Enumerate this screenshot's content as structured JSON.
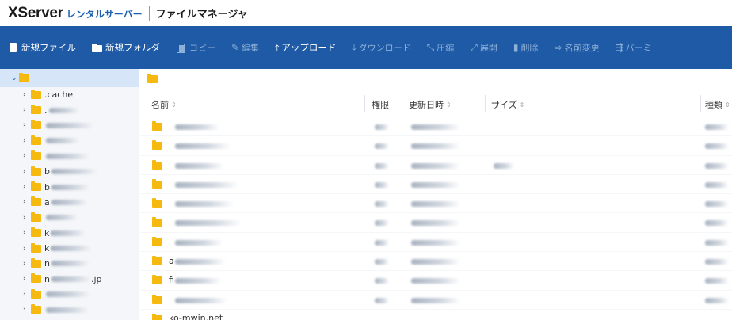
{
  "header": {
    "brand": "XServer",
    "brand_sub": "レンタルサーバー",
    "app_title": "ファイルマネージャ"
  },
  "toolbar": {
    "buttons": [
      {
        "label": "新規ファイル",
        "icon": "new-file-icon",
        "enabled": true
      },
      {
        "label": "新規フォルダ",
        "icon": "new-folder-icon",
        "enabled": true
      },
      {
        "label": "コピー",
        "icon": "copy-icon",
        "enabled": false
      },
      {
        "label": "編集",
        "icon": "pencil-icon",
        "enabled": false
      },
      {
        "label": "アップロード",
        "icon": "upload-icon",
        "enabled": true
      },
      {
        "label": "ダウンロード",
        "icon": "download-icon",
        "enabled": false
      },
      {
        "label": "圧縮",
        "icon": "compress-icon",
        "enabled": false
      },
      {
        "label": "展開",
        "icon": "expand-icon",
        "enabled": false
      },
      {
        "label": "削除",
        "icon": "trash-icon",
        "enabled": false
      },
      {
        "label": "名前変更",
        "icon": "rename-icon",
        "enabled": false
      },
      {
        "label": "パーミ",
        "icon": "permission-icon",
        "enabled": false
      }
    ]
  },
  "sidebar": {
    "items": [
      {
        "label": ".cache"
      },
      {
        "label": "."
      },
      {
        "label": ""
      },
      {
        "label": ""
      },
      {
        "label": ""
      },
      {
        "label": "b"
      },
      {
        "label": "b"
      },
      {
        "label": "a"
      },
      {
        "label": ""
      },
      {
        "label": "k"
      },
      {
        "label": "k"
      },
      {
        "label": "n"
      },
      {
        "label": "n",
        "suffix": ".jp"
      },
      {
        "label": ""
      },
      {
        "label": ""
      },
      {
        "label": ""
      }
    ]
  },
  "table": {
    "columns": [
      "名前",
      "権限",
      "更新日時",
      "サイズ",
      "種類"
    ],
    "rows": [
      {
        "name": ""
      },
      {
        "name": ""
      },
      {
        "name": ""
      },
      {
        "name": ""
      },
      {
        "name": ""
      },
      {
        "name": ""
      },
      {
        "name": ""
      },
      {
        "name": "a"
      },
      {
        "name": "fi"
      },
      {
        "name": ""
      }
    ],
    "last_row": "ko-mwin.net"
  },
  "colors": {
    "toolbar_bg": "#1e5aa6",
    "brand_accent": "#1a5fb0",
    "folder": "#f5b90f",
    "sidebar_selected": "#d6e6f8"
  }
}
